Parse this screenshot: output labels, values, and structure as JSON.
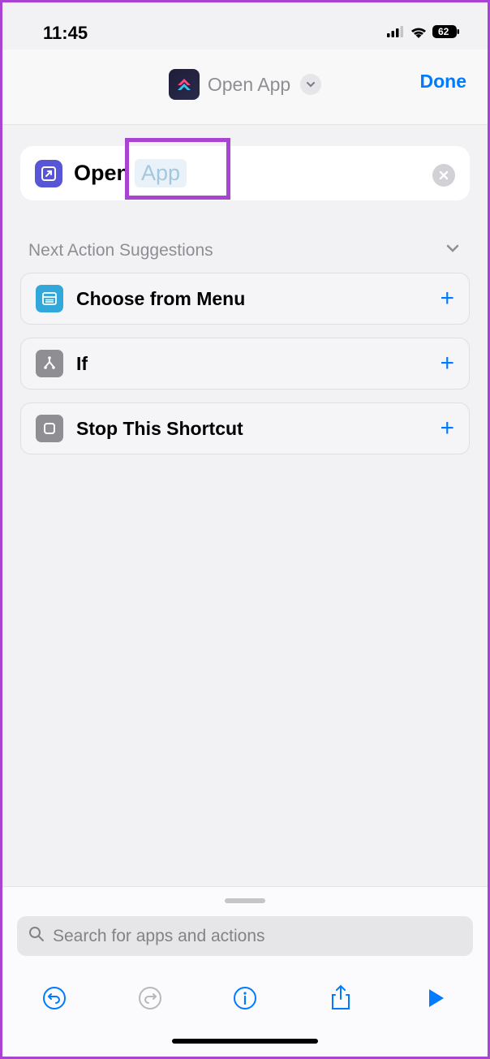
{
  "status": {
    "time": "11:45",
    "battery": "62"
  },
  "header": {
    "title": "Open App",
    "done": "Done"
  },
  "action": {
    "command": "Open",
    "param": "App"
  },
  "suggestions": {
    "title": "Next Action Suggestions",
    "items": [
      {
        "label": "Choose from Menu",
        "iconClass": "menu"
      },
      {
        "label": "If",
        "iconClass": "if"
      },
      {
        "label": "Stop This Shortcut",
        "iconClass": "stop"
      }
    ]
  },
  "search": {
    "placeholder": "Search for apps and actions"
  }
}
